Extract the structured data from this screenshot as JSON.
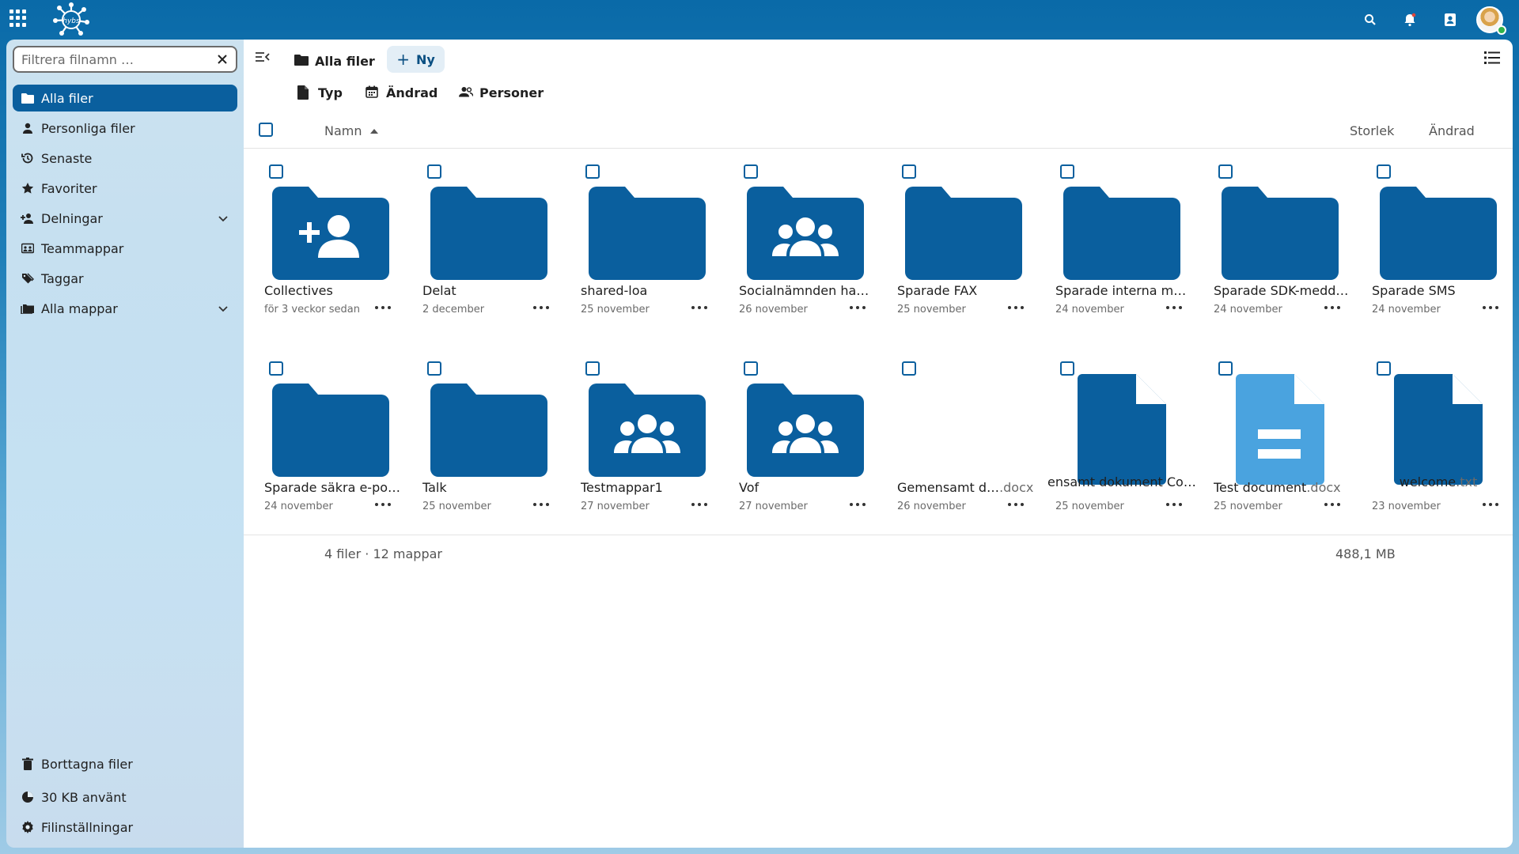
{
  "header": {
    "logo_text": "hybs",
    "icons": [
      "apps-grid-icon",
      "search-icon",
      "bell-icon",
      "contacts-icon",
      "avatar"
    ]
  },
  "sidebar": {
    "filter_placeholder": "Filtrera filnamn …",
    "items": [
      {
        "label": "Alla filer",
        "icon": "folder-icon",
        "active": true
      },
      {
        "label": "Personliga filer",
        "icon": "person-icon"
      },
      {
        "label": "Senaste",
        "icon": "history-icon"
      },
      {
        "label": "Favoriter",
        "icon": "star-icon"
      },
      {
        "label": "Delningar",
        "icon": "share-icon",
        "expandable": true
      },
      {
        "label": "Teammappar",
        "icon": "team-folder-icon"
      },
      {
        "label": "Taggar",
        "icon": "tag-icon"
      },
      {
        "label": "Alla mappar",
        "icon": "folders-icon",
        "expandable": true
      }
    ],
    "footer": {
      "trash": "Borttagna filer",
      "quota": "30 KB använt",
      "settings": "Filinställningar"
    }
  },
  "toolbar": {
    "breadcrumb": "Alla filer",
    "new_label": "Ny",
    "filters": [
      "Typ",
      "Ändrad",
      "Personer"
    ]
  },
  "columns": {
    "name": "Namn",
    "size": "Storlek",
    "modified": "Ändrad"
  },
  "files": [
    {
      "name": "Collectives",
      "ext": "",
      "date": "för 3 veckor sedan",
      "kind": "folder-shared-add"
    },
    {
      "name": "Delat",
      "ext": "",
      "date": "2 december",
      "kind": "folder"
    },
    {
      "name": "shared-loa",
      "ext": "",
      "date": "25 november",
      "kind": "folder"
    },
    {
      "name": "Socialnämnden ha…",
      "ext": "",
      "date": "26 november",
      "kind": "folder-group"
    },
    {
      "name": "Sparade FAX",
      "ext": "",
      "date": "25 november",
      "kind": "folder"
    },
    {
      "name": "Sparade interna m…",
      "ext": "",
      "date": "24 november",
      "kind": "folder"
    },
    {
      "name": "Sparade SDK-medd…",
      "ext": "",
      "date": "24 november",
      "kind": "folder"
    },
    {
      "name": "Sparade SMS",
      "ext": "",
      "date": "24 november",
      "kind": "folder"
    },
    {
      "name": "Sparade säkra e-po…",
      "ext": "",
      "date": "24 november",
      "kind": "folder"
    },
    {
      "name": "Talk",
      "ext": "",
      "date": "25 november",
      "kind": "folder"
    },
    {
      "name": "Testmappar1",
      "ext": "",
      "date": "27 november",
      "kind": "folder-group"
    },
    {
      "name": "Vof",
      "ext": "",
      "date": "27 november",
      "kind": "folder-group"
    },
    {
      "name": "Gemensamt d…",
      "ext": ".docx",
      "date": "26 november",
      "kind": "doc-preview"
    },
    {
      "name": "ensamt dokument Collabor",
      "ext": "",
      "date": "25 november",
      "kind": "file"
    },
    {
      "name": "Test document",
      "ext": ".docx",
      "date": "25 november",
      "kind": "text-file"
    },
    {
      "name": "welcome",
      "ext": ".txt",
      "date": "23 november",
      "kind": "file"
    }
  ],
  "summary": {
    "count": "4 filer · 12 mappar",
    "size": "488,1 MB"
  },
  "colors": {
    "accent": "#0a5f9e",
    "folder": "#0a5f9e",
    "text_file": "#4aa3df"
  }
}
